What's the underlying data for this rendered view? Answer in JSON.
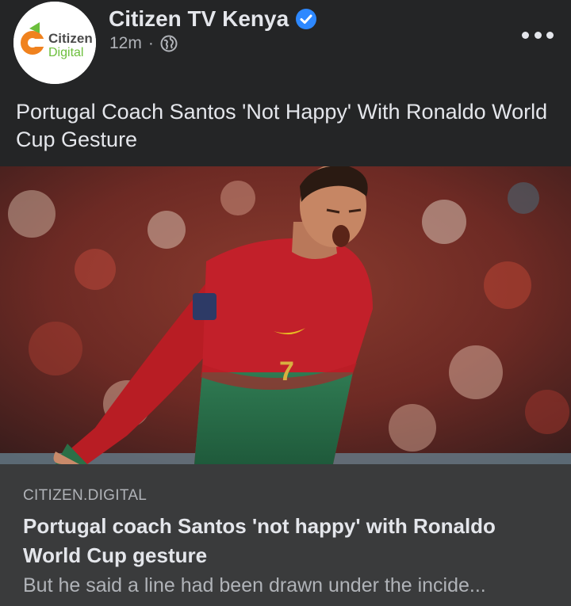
{
  "post": {
    "page_name": "Citizen TV Kenya",
    "verified": true,
    "timestamp": "12m",
    "separator": "·",
    "audience_icon": "globe-icon",
    "text": "Portugal Coach Santos 'Not Happy' With Ronaldo World Cup Gesture"
  },
  "avatar": {
    "logo_line1": "Citizen",
    "logo_line2": "Digital"
  },
  "link_preview": {
    "domain": "CITIZEN.DIGITAL",
    "title": "Portugal coach Santos 'not happy' with Ronaldo World Cup gesture",
    "description": "But he said a line had been drawn under the incide..."
  },
  "colors": {
    "background": "#242526",
    "card": "#3a3b3c",
    "verified": "#2d88ff",
    "text_primary": "#e4e6eb",
    "text_secondary": "#b0b3b8",
    "logo_orange": "#f0821e",
    "logo_green": "#6cbf3c"
  }
}
